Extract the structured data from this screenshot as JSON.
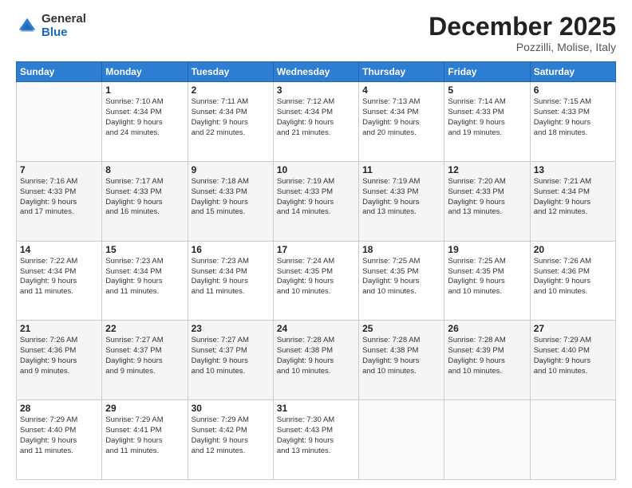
{
  "logo": {
    "general": "General",
    "blue": "Blue"
  },
  "header": {
    "title": "December 2025",
    "subtitle": "Pozzilli, Molise, Italy"
  },
  "days_of_week": [
    "Sunday",
    "Monday",
    "Tuesday",
    "Wednesday",
    "Thursday",
    "Friday",
    "Saturday"
  ],
  "weeks": [
    [
      {
        "day": "",
        "info": ""
      },
      {
        "day": "1",
        "info": "Sunrise: 7:10 AM\nSunset: 4:34 PM\nDaylight: 9 hours\nand 24 minutes."
      },
      {
        "day": "2",
        "info": "Sunrise: 7:11 AM\nSunset: 4:34 PM\nDaylight: 9 hours\nand 22 minutes."
      },
      {
        "day": "3",
        "info": "Sunrise: 7:12 AM\nSunset: 4:34 PM\nDaylight: 9 hours\nand 21 minutes."
      },
      {
        "day": "4",
        "info": "Sunrise: 7:13 AM\nSunset: 4:34 PM\nDaylight: 9 hours\nand 20 minutes."
      },
      {
        "day": "5",
        "info": "Sunrise: 7:14 AM\nSunset: 4:33 PM\nDaylight: 9 hours\nand 19 minutes."
      },
      {
        "day": "6",
        "info": "Sunrise: 7:15 AM\nSunset: 4:33 PM\nDaylight: 9 hours\nand 18 minutes."
      }
    ],
    [
      {
        "day": "7",
        "info": "Sunrise: 7:16 AM\nSunset: 4:33 PM\nDaylight: 9 hours\nand 17 minutes."
      },
      {
        "day": "8",
        "info": "Sunrise: 7:17 AM\nSunset: 4:33 PM\nDaylight: 9 hours\nand 16 minutes."
      },
      {
        "day": "9",
        "info": "Sunrise: 7:18 AM\nSunset: 4:33 PM\nDaylight: 9 hours\nand 15 minutes."
      },
      {
        "day": "10",
        "info": "Sunrise: 7:19 AM\nSunset: 4:33 PM\nDaylight: 9 hours\nand 14 minutes."
      },
      {
        "day": "11",
        "info": "Sunrise: 7:19 AM\nSunset: 4:33 PM\nDaylight: 9 hours\nand 13 minutes."
      },
      {
        "day": "12",
        "info": "Sunrise: 7:20 AM\nSunset: 4:33 PM\nDaylight: 9 hours\nand 13 minutes."
      },
      {
        "day": "13",
        "info": "Sunrise: 7:21 AM\nSunset: 4:34 PM\nDaylight: 9 hours\nand 12 minutes."
      }
    ],
    [
      {
        "day": "14",
        "info": "Sunrise: 7:22 AM\nSunset: 4:34 PM\nDaylight: 9 hours\nand 11 minutes."
      },
      {
        "day": "15",
        "info": "Sunrise: 7:23 AM\nSunset: 4:34 PM\nDaylight: 9 hours\nand 11 minutes."
      },
      {
        "day": "16",
        "info": "Sunrise: 7:23 AM\nSunset: 4:34 PM\nDaylight: 9 hours\nand 11 minutes."
      },
      {
        "day": "17",
        "info": "Sunrise: 7:24 AM\nSunset: 4:35 PM\nDaylight: 9 hours\nand 10 minutes."
      },
      {
        "day": "18",
        "info": "Sunrise: 7:25 AM\nSunset: 4:35 PM\nDaylight: 9 hours\nand 10 minutes."
      },
      {
        "day": "19",
        "info": "Sunrise: 7:25 AM\nSunset: 4:35 PM\nDaylight: 9 hours\nand 10 minutes."
      },
      {
        "day": "20",
        "info": "Sunrise: 7:26 AM\nSunset: 4:36 PM\nDaylight: 9 hours\nand 10 minutes."
      }
    ],
    [
      {
        "day": "21",
        "info": "Sunrise: 7:26 AM\nSunset: 4:36 PM\nDaylight: 9 hours\nand 9 minutes."
      },
      {
        "day": "22",
        "info": "Sunrise: 7:27 AM\nSunset: 4:37 PM\nDaylight: 9 hours\nand 9 minutes."
      },
      {
        "day": "23",
        "info": "Sunrise: 7:27 AM\nSunset: 4:37 PM\nDaylight: 9 hours\nand 10 minutes."
      },
      {
        "day": "24",
        "info": "Sunrise: 7:28 AM\nSunset: 4:38 PM\nDaylight: 9 hours\nand 10 minutes."
      },
      {
        "day": "25",
        "info": "Sunrise: 7:28 AM\nSunset: 4:38 PM\nDaylight: 9 hours\nand 10 minutes."
      },
      {
        "day": "26",
        "info": "Sunrise: 7:28 AM\nSunset: 4:39 PM\nDaylight: 9 hours\nand 10 minutes."
      },
      {
        "day": "27",
        "info": "Sunrise: 7:29 AM\nSunset: 4:40 PM\nDaylight: 9 hours\nand 10 minutes."
      }
    ],
    [
      {
        "day": "28",
        "info": "Sunrise: 7:29 AM\nSunset: 4:40 PM\nDaylight: 9 hours\nand 11 minutes."
      },
      {
        "day": "29",
        "info": "Sunrise: 7:29 AM\nSunset: 4:41 PM\nDaylight: 9 hours\nand 11 minutes."
      },
      {
        "day": "30",
        "info": "Sunrise: 7:29 AM\nSunset: 4:42 PM\nDaylight: 9 hours\nand 12 minutes."
      },
      {
        "day": "31",
        "info": "Sunrise: 7:30 AM\nSunset: 4:43 PM\nDaylight: 9 hours\nand 13 minutes."
      },
      {
        "day": "",
        "info": ""
      },
      {
        "day": "",
        "info": ""
      },
      {
        "day": "",
        "info": ""
      }
    ]
  ]
}
